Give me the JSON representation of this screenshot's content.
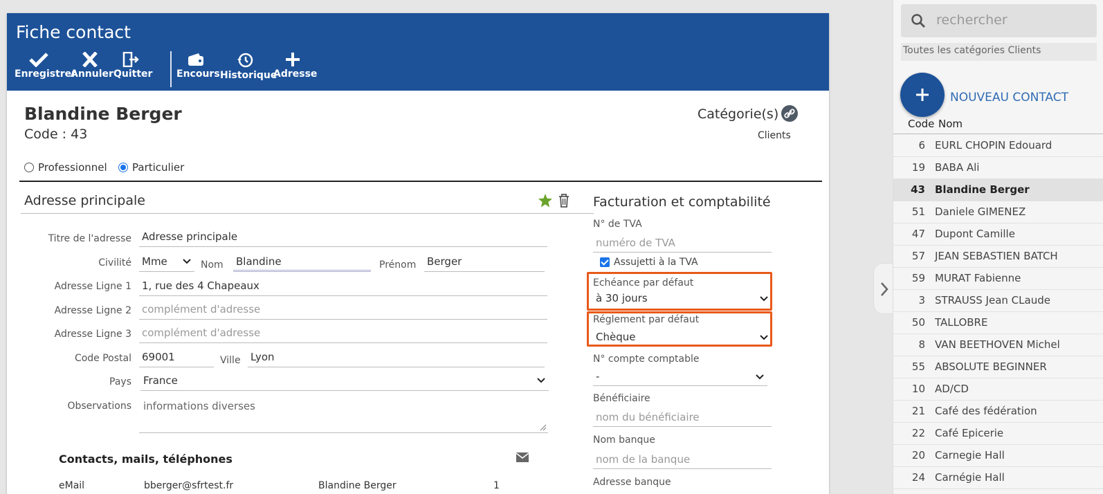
{
  "header": {
    "title": "Fiche contact",
    "toolbar": [
      {
        "label": "Enregistrer",
        "icon": "check-icon"
      },
      {
        "label": "Annuler",
        "icon": "close-icon"
      },
      {
        "label": "Quitter",
        "icon": "exit-icon"
      },
      {
        "label": "Encours",
        "icon": "wallet-icon"
      },
      {
        "label": "Historique",
        "icon": "history-icon"
      },
      {
        "label": "Adresse",
        "icon": "plus-icon"
      }
    ]
  },
  "contact": {
    "name": "Blandine Berger",
    "code": "Code : 43",
    "category_label": "Catégorie(s)",
    "category_value": "Clients",
    "type_professional": "Professionnel",
    "type_private": "Particulier",
    "type_selected": "Particulier"
  },
  "address": {
    "section_title": "Adresse principale",
    "labels": {
      "title": "Titre de l'adresse",
      "civility": "Civilité",
      "lastname": "Nom",
      "firstname": "Prénom",
      "line1": "Adresse Ligne 1",
      "line2": "Adresse Ligne 2",
      "line3": "Adresse Ligne 3",
      "postal": "Code Postal",
      "city": "Ville",
      "country": "Pays",
      "observations": "Observations"
    },
    "values": {
      "title": "Adresse principale",
      "civility": "Mme",
      "lastname": "Blandine",
      "firstname": "Berger",
      "line1": "1, rue des 4 Chapeaux",
      "line2_placeholder": "complément d'adresse",
      "line3_placeholder": "complément d'adresse",
      "postal": "69001",
      "city": "Lyon",
      "country": "France",
      "observations": "informations diverses"
    }
  },
  "contacts": {
    "title": "Contacts, mails, téléphones",
    "row": {
      "type": "eMail",
      "value": "bberger@sfrtest.fr",
      "name": "Blandine Berger",
      "num": "1"
    }
  },
  "billing": {
    "section_title": "Facturation et comptabilité",
    "vat_label": "N° de TVA",
    "vat_placeholder": "numéro de TVA",
    "vat_subject": "Assujetti à la TVA",
    "due_label": "Echéance par défaut",
    "due_value": "à 30 jours",
    "payment_label": "Réglement par défaut",
    "payment_value": "Chèque",
    "account_label": "N° compte comptable",
    "account_value": "-",
    "beneficiary_label": "Bénéficiaire",
    "beneficiary_placeholder": "nom du bénéficiaire",
    "bank_label": "Nom banque",
    "bank_placeholder": "nom de la banque",
    "bank_address_label": "Adresse banque",
    "highlight_color": "#e8591a"
  },
  "sidebar": {
    "search_placeholder": "rechercher",
    "category_filter": "Toutes les catégories Clients",
    "new_contact": "NOUVEAU CONTACT",
    "col_code": "Code",
    "col_name": "Nom",
    "items": [
      {
        "code": "6",
        "name": "EURL CHOPIN Edouard"
      },
      {
        "code": "19",
        "name": "BABA Ali"
      },
      {
        "code": "43",
        "name": "Blandine Berger",
        "selected": true
      },
      {
        "code": "51",
        "name": "Daniele GIMENEZ"
      },
      {
        "code": "47",
        "name": "Dupont Camille"
      },
      {
        "code": "57",
        "name": "JEAN SEBASTIEN BATCH"
      },
      {
        "code": "59",
        "name": "MURAT Fabienne"
      },
      {
        "code": "3",
        "name": "STRAUSS Jean CLaude"
      },
      {
        "code": "50",
        "name": "TALLOBRE"
      },
      {
        "code": "8",
        "name": "VAN BEETHOVEN Michel"
      },
      {
        "code": "55",
        "name": "ABSOLUTE BEGINNER"
      },
      {
        "code": "10",
        "name": "AD/CD"
      },
      {
        "code": "21",
        "name": "Café des fédération"
      },
      {
        "code": "22",
        "name": "Café Epicerie"
      },
      {
        "code": "20",
        "name": "Carnegie Hall"
      },
      {
        "code": "24",
        "name": "Carnégie Hall"
      }
    ]
  },
  "colors": {
    "brand": "#1d5299",
    "accent": "#2f6bb3",
    "star": "#6aa32b"
  }
}
